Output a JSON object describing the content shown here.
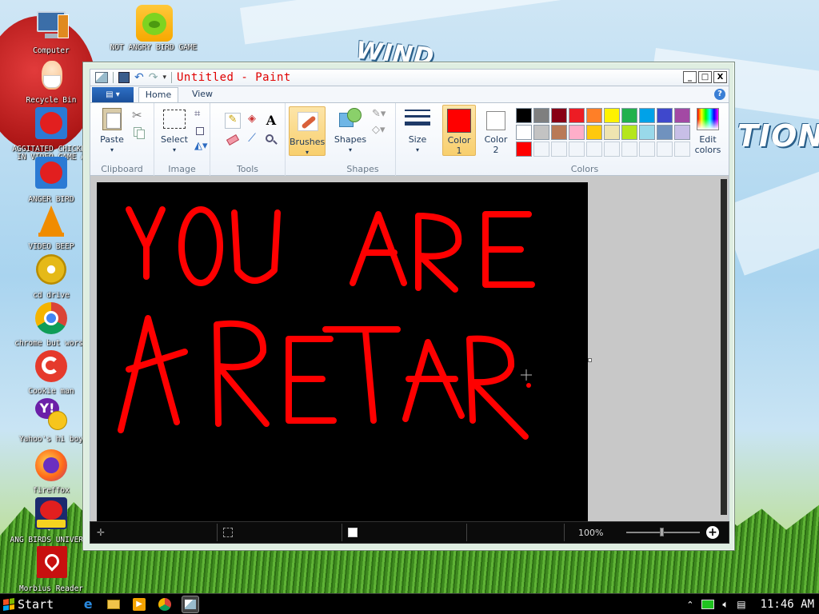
{
  "desktop": {
    "icons": [
      {
        "label": "Computer"
      },
      {
        "label": "Recycle Bin"
      },
      {
        "label": "AGGITATED CHICKEN IN VIDEO GAME A"
      },
      {
        "label": "ANGER BIRD"
      },
      {
        "label": "VIDEO BEEP"
      },
      {
        "label": "cd drive"
      },
      {
        "label": "chrome but worse"
      },
      {
        "label": "Cookie man"
      },
      {
        "label": "Yahoo's hi boy"
      },
      {
        "label": "fireffox"
      },
      {
        "label": "ANG BIRDS UNIVERSE"
      },
      {
        "label": "Morbius Reader"
      },
      {
        "label": "NOT ANGRY BIRD GAME"
      }
    ],
    "wallpaper_text": [
      "WIND",
      "TION"
    ]
  },
  "paint": {
    "title": "Untitled - Paint",
    "app_menu_label": "▤ ▾",
    "tabs": [
      {
        "label": "Home"
      },
      {
        "label": "View"
      }
    ],
    "help_label": "?",
    "window_buttons": {
      "minimize": "_",
      "maximize": "□",
      "close": "X"
    },
    "ribbon": {
      "groups": {
        "clipboard": "Clipboard",
        "image": "Image",
        "tools": "Tools",
        "shapes": "Shapes",
        "colors": "Colors"
      },
      "paste": "Paste",
      "select": "Select",
      "brushes": "Brushes",
      "shapes_btn": "Shapes",
      "size": "Size",
      "color1": "Color 1",
      "color2": "Color 2",
      "edit_colors": "Edit colors",
      "palette_colors": [
        "#000000",
        "#7f7f7f",
        "#880015",
        "#ed1c24",
        "#ff7f27",
        "#fff200",
        "#22b14c",
        "#00a2e8",
        "#3f48cc",
        "#a349a4",
        "#ffffff",
        "#c3c3c3",
        "#b97a57",
        "#ffaec9",
        "#ffc90e",
        "#efe4b0",
        "#b5e61d",
        "#99d9ea",
        "#7092be",
        "#c8bfe7",
        "#ff0000",
        "",
        "",
        "",
        "",
        "",
        "",
        "",
        "",
        ""
      ],
      "color1_value": "#ff0000",
      "color2_value": "#ffffff"
    },
    "canvas": {
      "background": "#000000",
      "drawing_text_line1": "YOU ARE",
      "drawing_text_line2": "ARETAR",
      "stroke_color": "#ff0000"
    },
    "status": {
      "zoom": "100%"
    }
  },
  "taskbar": {
    "start_label": "Start",
    "clock": "11:46 AM"
  }
}
